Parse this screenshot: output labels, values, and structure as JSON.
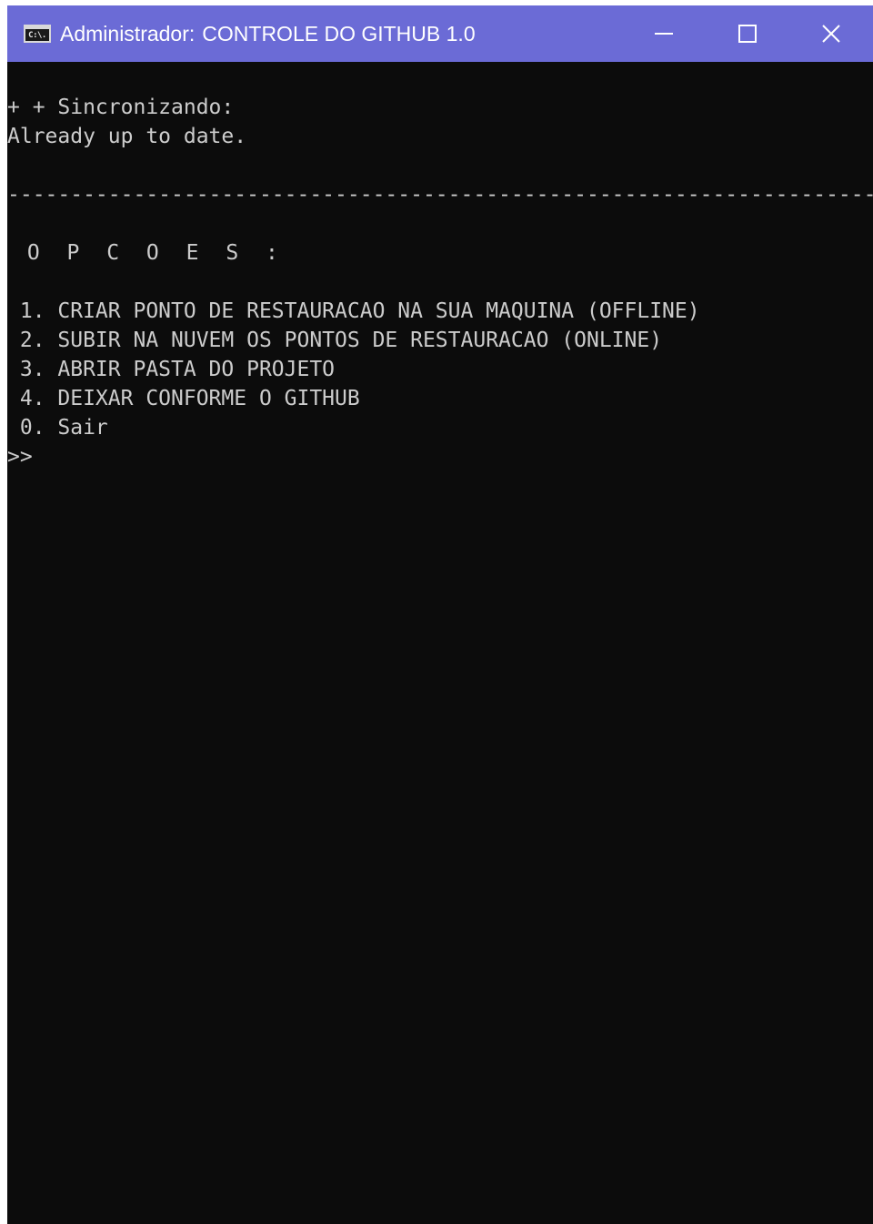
{
  "window": {
    "title_prefix": "Administrador:",
    "title": "CONTROLE DO GITHUB 1.0",
    "icon_text": "C:\\."
  },
  "console": {
    "sync_line": "+ + Sincronizando:",
    "status_line": "Already up to date.",
    "divider": "------------------------------------------------------------------------------------------",
    "options_heading": " O P C O E S :",
    "options": [
      " 1. CRIAR PONTO DE RESTAURACAO NA SUA MAQUINA (OFFLINE)",
      " 2. SUBIR NA NUVEM OS PONTOS DE RESTAURACAO (ONLINE)",
      " 3. ABRIR PASTA DO PROJETO",
      " 4. DEIXAR CONFORME O GITHUB",
      " 0. Sair"
    ],
    "prompt": ">>"
  },
  "colors": {
    "titlebar": "#6b6bd6",
    "console_bg": "#0c0c0c",
    "console_text": "#cccccc"
  }
}
